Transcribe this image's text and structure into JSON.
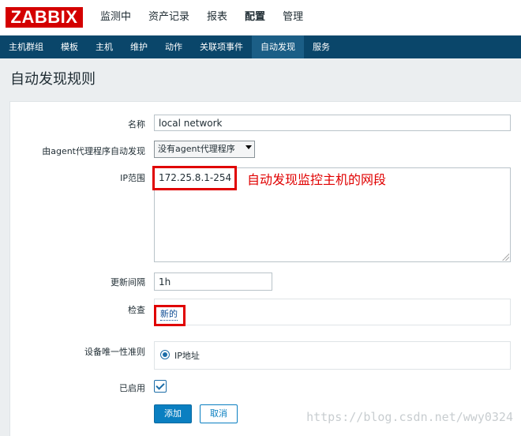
{
  "brand": {
    "logo": "ZABBIX"
  },
  "top_menu": [
    {
      "label": "监测中"
    },
    {
      "label": "资产记录"
    },
    {
      "label": "报表"
    },
    {
      "label": "配置",
      "active": true
    },
    {
      "label": "管理"
    }
  ],
  "sub_nav": [
    {
      "label": "主机群组"
    },
    {
      "label": "模板"
    },
    {
      "label": "主机"
    },
    {
      "label": "维护"
    },
    {
      "label": "动作"
    },
    {
      "label": "关联项事件"
    },
    {
      "label": "自动发现",
      "active": true
    },
    {
      "label": "服务"
    }
  ],
  "page": {
    "title": "自动发现规则"
  },
  "form": {
    "name_label": "名称",
    "name_value": "local network",
    "proxy_label": "由agent代理程序自动发现",
    "proxy_value": "没有agent代理程序",
    "ip_range_label": "IP范围",
    "ip_range_value": "172.25.8.1-254",
    "annotation": "自动发现监控主机的网段",
    "interval_label": "更新间隔",
    "interval_value": "1h",
    "checks_label": "检查",
    "checks_new_link": "新的",
    "uniqueness_label": "设备唯一性准则",
    "uniqueness_option": "IP地址",
    "enabled_label": "已启用",
    "enabled": true,
    "add_button": "添加",
    "cancel_button": "取消"
  },
  "watermark": "https://blog.csdn.net/wwy0324",
  "colors": {
    "brand_red": "#d40000",
    "nav_blue": "#0a466a",
    "accent_blue": "#0a7fc1",
    "annotation_red": "#e00000"
  }
}
